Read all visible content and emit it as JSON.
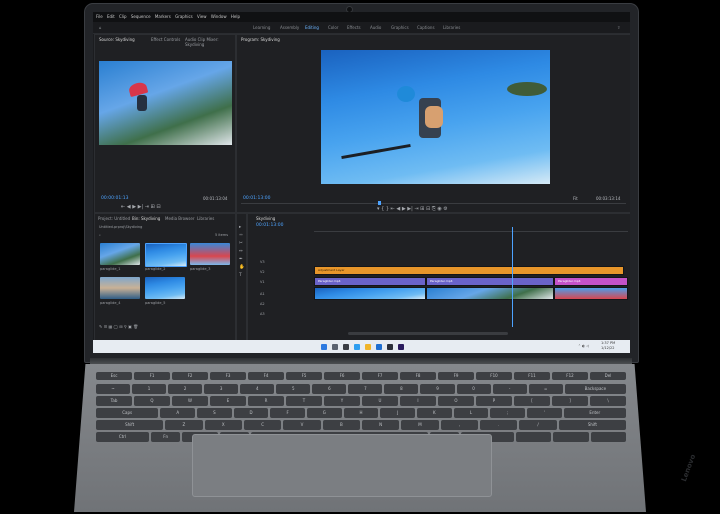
{
  "menubar": {
    "items": [
      "File",
      "Edit",
      "Clip",
      "Sequence",
      "Markers",
      "Graphics",
      "View",
      "Window",
      "Help"
    ]
  },
  "workspaces": {
    "items": [
      "Learning",
      "Assembly",
      "Editing",
      "Color",
      "Effects",
      "Audio",
      "Graphics",
      "Captions",
      "Libraries"
    ],
    "active": "Editing"
  },
  "source_panel": {
    "tabs": [
      "Source: Skydiving",
      "Effect Controls",
      "Audio Clip Mixer: Skydiving"
    ],
    "timecode_left": "00:00:01:13",
    "timecode_right": "00:01:13:04"
  },
  "program_panel": {
    "tab": "Program: Skydiving",
    "timecode_left": "00:01:13:00",
    "timecode_right": "00:03:13:14",
    "fit": "Fit"
  },
  "project_panel": {
    "tabs": [
      "Project: Untitled",
      "Bin: Skydiving",
      "Media Browser",
      "Libraries"
    ],
    "path": "Untitled.prproj\\Skydiving",
    "count": "5 items",
    "clips": [
      "paraglide_1",
      "paraglide_2",
      "paraglide_3",
      "paraglide_4",
      "paraglide_5"
    ]
  },
  "timeline_panel": {
    "tab": "Skydiving",
    "timecode": "00:01:13:00",
    "tracks": [
      "V3",
      "V2",
      "V1",
      "A1",
      "A2",
      "A3"
    ],
    "clip_labels": [
      "Adjustment Layer",
      "Paraglider.mp4",
      "Paraglider.mp4",
      "Paraglider.mp4"
    ]
  },
  "taskbar": {
    "time": "1:37 PM",
    "date": "1/12/22"
  },
  "keyboard": {
    "rows": [
      [
        "Esc",
        "F1",
        "F2",
        "F3",
        "F4",
        "F5",
        "F6",
        "F7",
        "F8",
        "F9",
        "F10",
        "F11",
        "F12",
        "Del"
      ],
      [
        "~",
        "1",
        "2",
        "3",
        "4",
        "5",
        "6",
        "7",
        "8",
        "9",
        "0",
        "-",
        "=",
        "Backspace"
      ],
      [
        "Tab",
        "Q",
        "W",
        "E",
        "R",
        "T",
        "Y",
        "U",
        "I",
        "O",
        "P",
        "[",
        "]",
        "\\"
      ],
      [
        "Caps",
        "A",
        "S",
        "D",
        "F",
        "G",
        "H",
        "J",
        "K",
        "L",
        ";",
        "'",
        "Enter"
      ],
      [
        "Shift",
        "Z",
        "X",
        "C",
        "V",
        "B",
        "N",
        "M",
        ",",
        ".",
        "/",
        "Shift"
      ],
      [
        "Ctrl",
        "Fn",
        "",
        "Alt",
        "",
        "Alt",
        "Ctrl",
        "",
        "",
        ""
      ]
    ]
  },
  "brand": {
    "logo": "Lenovo"
  }
}
